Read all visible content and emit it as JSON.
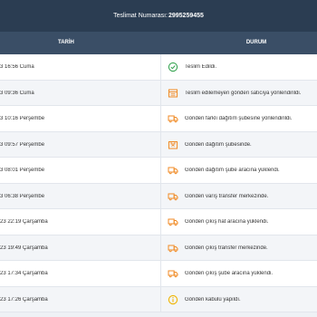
{
  "header": {
    "tracking_label": "Teslimat Numarası:",
    "tracking_number": "2995259455"
  },
  "table": {
    "columns": {
      "date": "TARİH",
      "status": "DURUM"
    },
    "rows": [
      {
        "date": "3 16:56 Cuma",
        "status": "Teslim Edildi.",
        "icon": "check-circle"
      },
      {
        "date": "3 09:36 Cuma",
        "status": "Teslim edilemeyen gönderi satıcıya yönlendirildi.",
        "icon": "return-box"
      },
      {
        "date": "3 10:16 Perşembe",
        "status": "Gönderi farklı dağıtım şubesine yönlendirildi.",
        "icon": "truck"
      },
      {
        "date": "3 09:57 Perşembe",
        "status": "Gönderi dağıtım şubesinde.",
        "icon": "branch-box"
      },
      {
        "date": "3 08:01 Perşembe",
        "status": "Gönderi dağıtım şube aracına yüklendi.",
        "icon": "truck"
      },
      {
        "date": "3 06:38 Perşembe",
        "status": "Gönderi varış transfer merkezinde.",
        "icon": "truck"
      },
      {
        "date": "23 22:19 Çarşamba",
        "status": "Gönderi çıkış hat aracına yüklendi.",
        "icon": "truck"
      },
      {
        "date": "23 19:49 Çarşamba",
        "status": "Gönderi çıkış transfer merkezinde.",
        "icon": "truck"
      },
      {
        "date": "23 17:34 Çarşamba",
        "status": "Gönderi çıkış şube aracına yüklendi.",
        "icon": "truck"
      },
      {
        "date": "23 17:26 Çarşamba",
        "status": "Gönderi kabulü yapıldı.",
        "icon": "info-circle"
      }
    ]
  },
  "colors": {
    "topbar": "#2b3d52",
    "header": "#3a4e66",
    "icon_orange": "#f08a24",
    "icon_green": "#3aa655",
    "icon_yellow": "#f0b400"
  }
}
